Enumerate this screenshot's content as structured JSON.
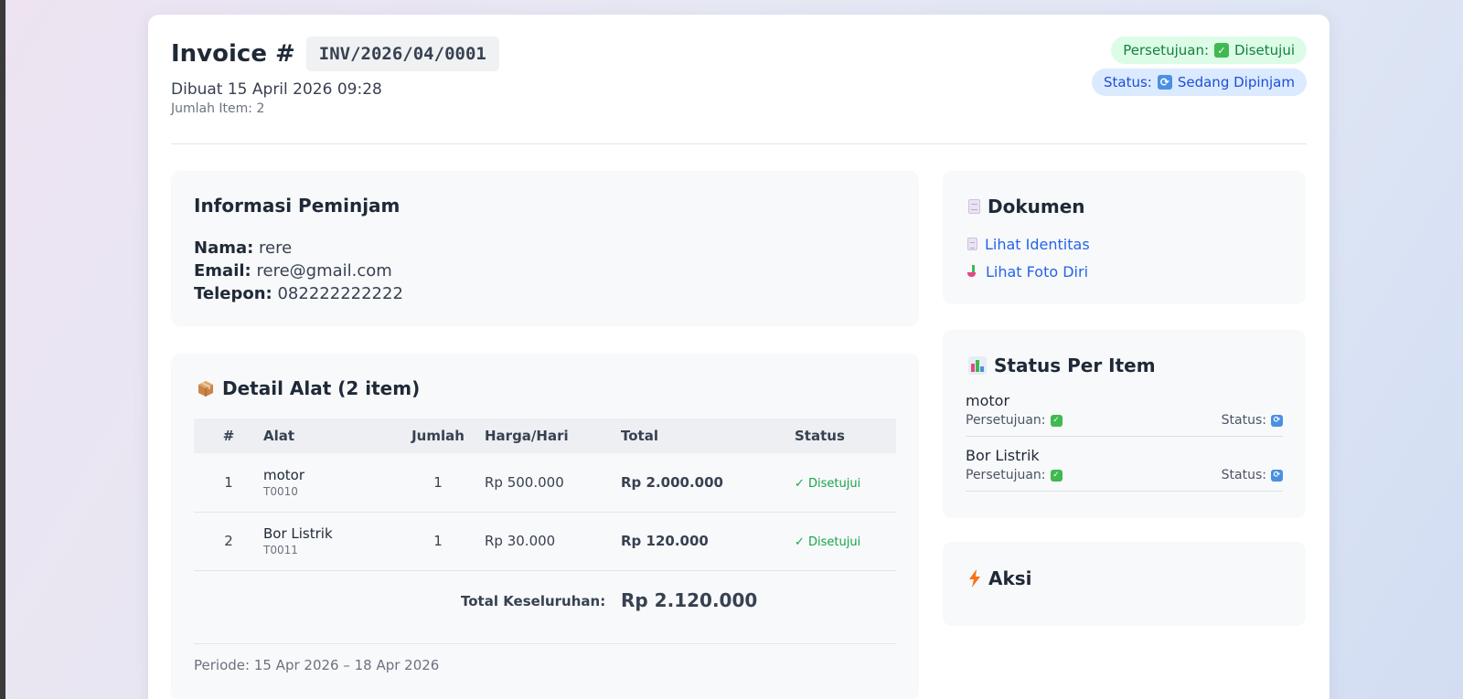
{
  "invoice": {
    "title": "Invoice #",
    "code": "INV/2026/04/0001",
    "created": "Dibuat 15 April 2026 09:28",
    "item_count": "Jumlah Item: 2",
    "approval_label": "Persetujuan:",
    "approval_value": "Disetujui",
    "status_label": "Status:",
    "status_value": "Sedang Dipinjam"
  },
  "borrower": {
    "heading": "Informasi Peminjam",
    "name_label": "Nama:",
    "name": "rere",
    "email_label": "Email:",
    "email": "rere@gmail.com",
    "phone_label": "Telepon:",
    "phone": "082222222222"
  },
  "detail": {
    "heading": "Detail Alat (2 item)",
    "columns": [
      "#",
      "Alat",
      "Jumlah",
      "Harga/Hari",
      "Total",
      "Status"
    ],
    "rows": [
      {
        "no": "1",
        "name": "motor",
        "code": "T0010",
        "qty": "1",
        "price": "Rp 500.000",
        "total": "Rp 2.000.000",
        "status": "✓ Disetujui"
      },
      {
        "no": "2",
        "name": "Bor Listrik",
        "code": "T0011",
        "qty": "1",
        "price": "Rp 30.000",
        "total": "Rp 120.000",
        "status": "✓ Disetujui"
      }
    ],
    "grand_total_label": "Total Keseluruhan:",
    "grand_total": "Rp 2.120.000",
    "period": "Periode: 15 Apr 2026 – 18 Apr 2026"
  },
  "documents": {
    "heading": "Dokumen",
    "links": [
      "Lihat Identitas",
      "Lihat Foto Diri"
    ]
  },
  "status_per_item": {
    "heading": "Status Per Item",
    "approval_label": "Persetujuan:",
    "status_label": "Status:",
    "items": [
      {
        "name": "motor"
      },
      {
        "name": "Bor Listrik"
      }
    ]
  },
  "actions": {
    "heading": "Aksi"
  },
  "colors": {
    "accent_green": "#16a34a",
    "accent_blue": "#2563eb",
    "panel_bg": "#f8f9fa"
  }
}
